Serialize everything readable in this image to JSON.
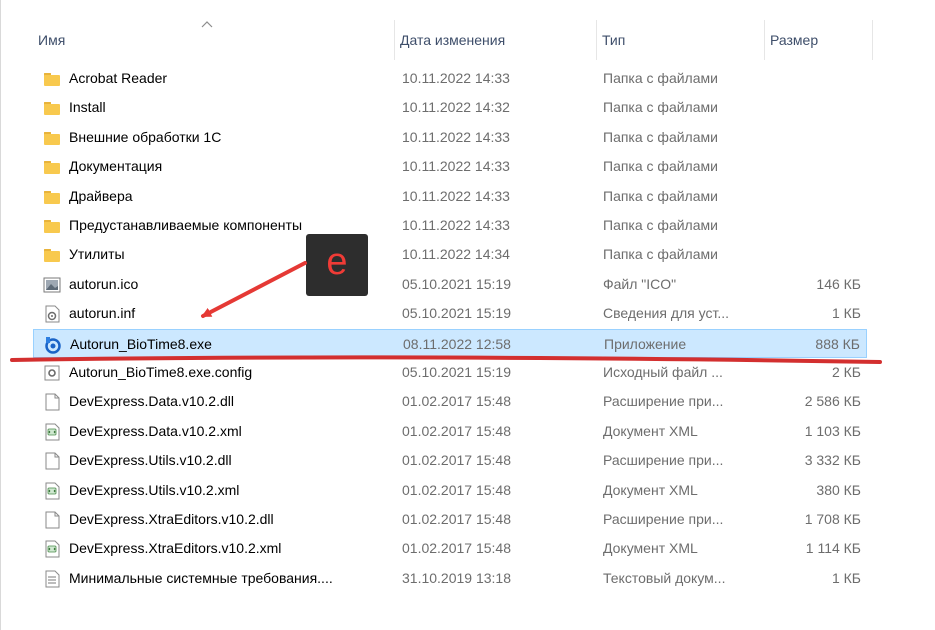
{
  "columns": {
    "name": "Имя",
    "date": "Дата изменения",
    "type": "Тип",
    "size": "Размер"
  },
  "files": [
    {
      "name": "Acrobat Reader",
      "date": "10.11.2022 14:33",
      "type": "Папка с файлами",
      "size": "",
      "icon": "folder-icon"
    },
    {
      "name": "Install",
      "date": "10.11.2022 14:32",
      "type": "Папка с файлами",
      "size": "",
      "icon": "folder-icon"
    },
    {
      "name": "Внешние обработки 1С",
      "date": "10.11.2022 14:33",
      "type": "Папка с файлами",
      "size": "",
      "icon": "folder-icon"
    },
    {
      "name": "Документация",
      "date": "10.11.2022 14:33",
      "type": "Папка с файлами",
      "size": "",
      "icon": "folder-icon"
    },
    {
      "name": "Драйвера",
      "date": "10.11.2022 14:33",
      "type": "Папка с файлами",
      "size": "",
      "icon": "folder-icon"
    },
    {
      "name": "Предустанавливаемые компоненты",
      "date": "10.11.2022 14:33",
      "type": "Папка с файлами",
      "size": "",
      "icon": "folder-icon"
    },
    {
      "name": "Утилиты",
      "date": "10.11.2022 14:34",
      "type": "Папка с файлами",
      "size": "",
      "icon": "folder-icon"
    },
    {
      "name": "autorun.ico",
      "date": "05.10.2021 15:19",
      "type": "Файл \"ICO\"",
      "size": "146 КБ",
      "icon": "image-file-icon"
    },
    {
      "name": "autorun.inf",
      "date": "05.10.2021 15:19",
      "type": "Сведения для уст...",
      "size": "1 КБ",
      "icon": "settings-file-icon"
    },
    {
      "name": "Autorun_BioTime8.exe",
      "date": "08.11.2022 12:58",
      "type": "Приложение",
      "size": "888 КБ",
      "icon": "app-exe-icon",
      "selected": true
    },
    {
      "name": "Autorun_BioTime8.exe.config",
      "date": "05.10.2021 15:19",
      "type": "Исходный файл ...",
      "size": "2 КБ",
      "icon": "config-file-icon"
    },
    {
      "name": "DevExpress.Data.v10.2.dll",
      "date": "01.02.2017 15:48",
      "type": "Расширение при...",
      "size": "2 586 КБ",
      "icon": "blank-file-icon"
    },
    {
      "name": "DevExpress.Data.v10.2.xml",
      "date": "01.02.2017 15:48",
      "type": "Документ XML",
      "size": "1 103 КБ",
      "icon": "xml-file-icon"
    },
    {
      "name": "DevExpress.Utils.v10.2.dll",
      "date": "01.02.2017 15:48",
      "type": "Расширение при...",
      "size": "3 332 КБ",
      "icon": "blank-file-icon"
    },
    {
      "name": "DevExpress.Utils.v10.2.xml",
      "date": "01.02.2017 15:48",
      "type": "Документ XML",
      "size": "380 КБ",
      "icon": "xml-file-icon"
    },
    {
      "name": "DevExpress.XtraEditors.v10.2.dll",
      "date": "01.02.2017 15:48",
      "type": "Расширение при...",
      "size": "1 708 КБ",
      "icon": "blank-file-icon"
    },
    {
      "name": "DevExpress.XtraEditors.v10.2.xml",
      "date": "01.02.2017 15:48",
      "type": "Документ XML",
      "size": "1 114 КБ",
      "icon": "xml-file-icon"
    },
    {
      "name": "Минимальные системные требования....",
      "date": "31.10.2019 13:18",
      "type": "Текстовый докум...",
      "size": "1 КБ",
      "icon": "text-file-icon"
    }
  ],
  "annotation": {
    "label": "e",
    "color": "#e53935"
  },
  "colors": {
    "selected_row": "#cce8ff",
    "selected_border": "#99d1ff",
    "folder": "#f8c94e",
    "header_text": "#3e4e6a"
  }
}
